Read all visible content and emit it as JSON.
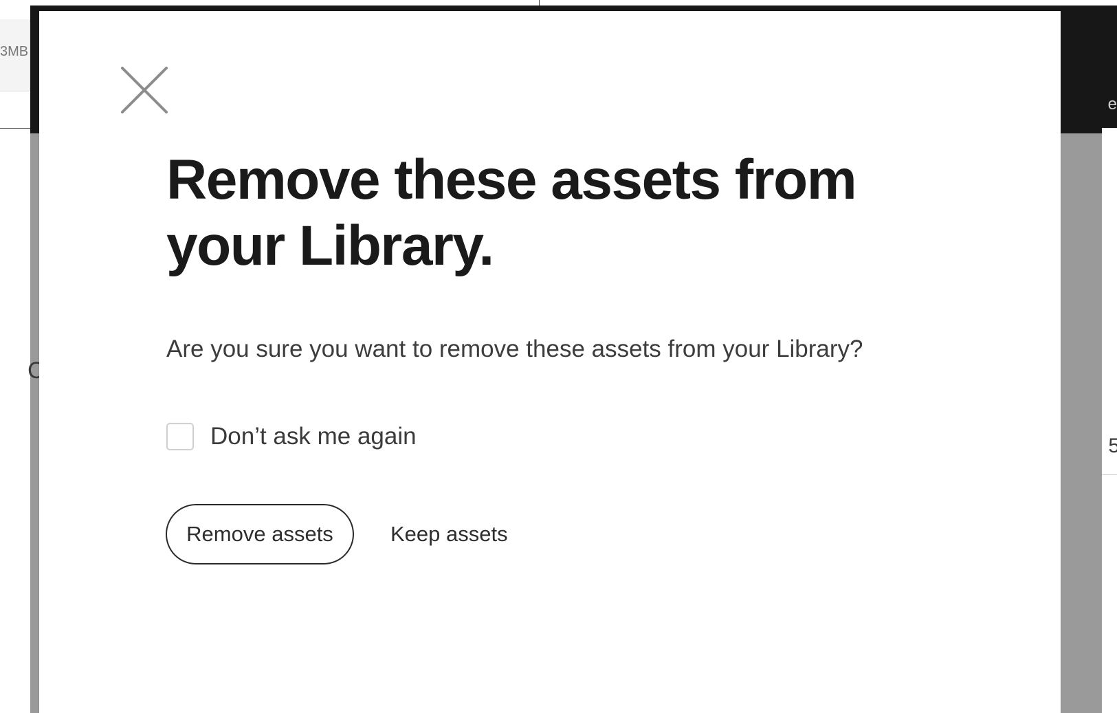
{
  "background": {
    "size_label": "3MB",
    "side_char_left": "C",
    "side_char_right": "5",
    "topbar_side_char": "e"
  },
  "dialog": {
    "close_label": "Close",
    "title": "Remove these assets from your Library.",
    "description": "Are you sure you want to remove these assets from your Library?",
    "checkbox": {
      "label": "Don’t ask me again",
      "checked": false
    },
    "primary_button": "Remove assets",
    "secondary_button": "Keep assets"
  }
}
